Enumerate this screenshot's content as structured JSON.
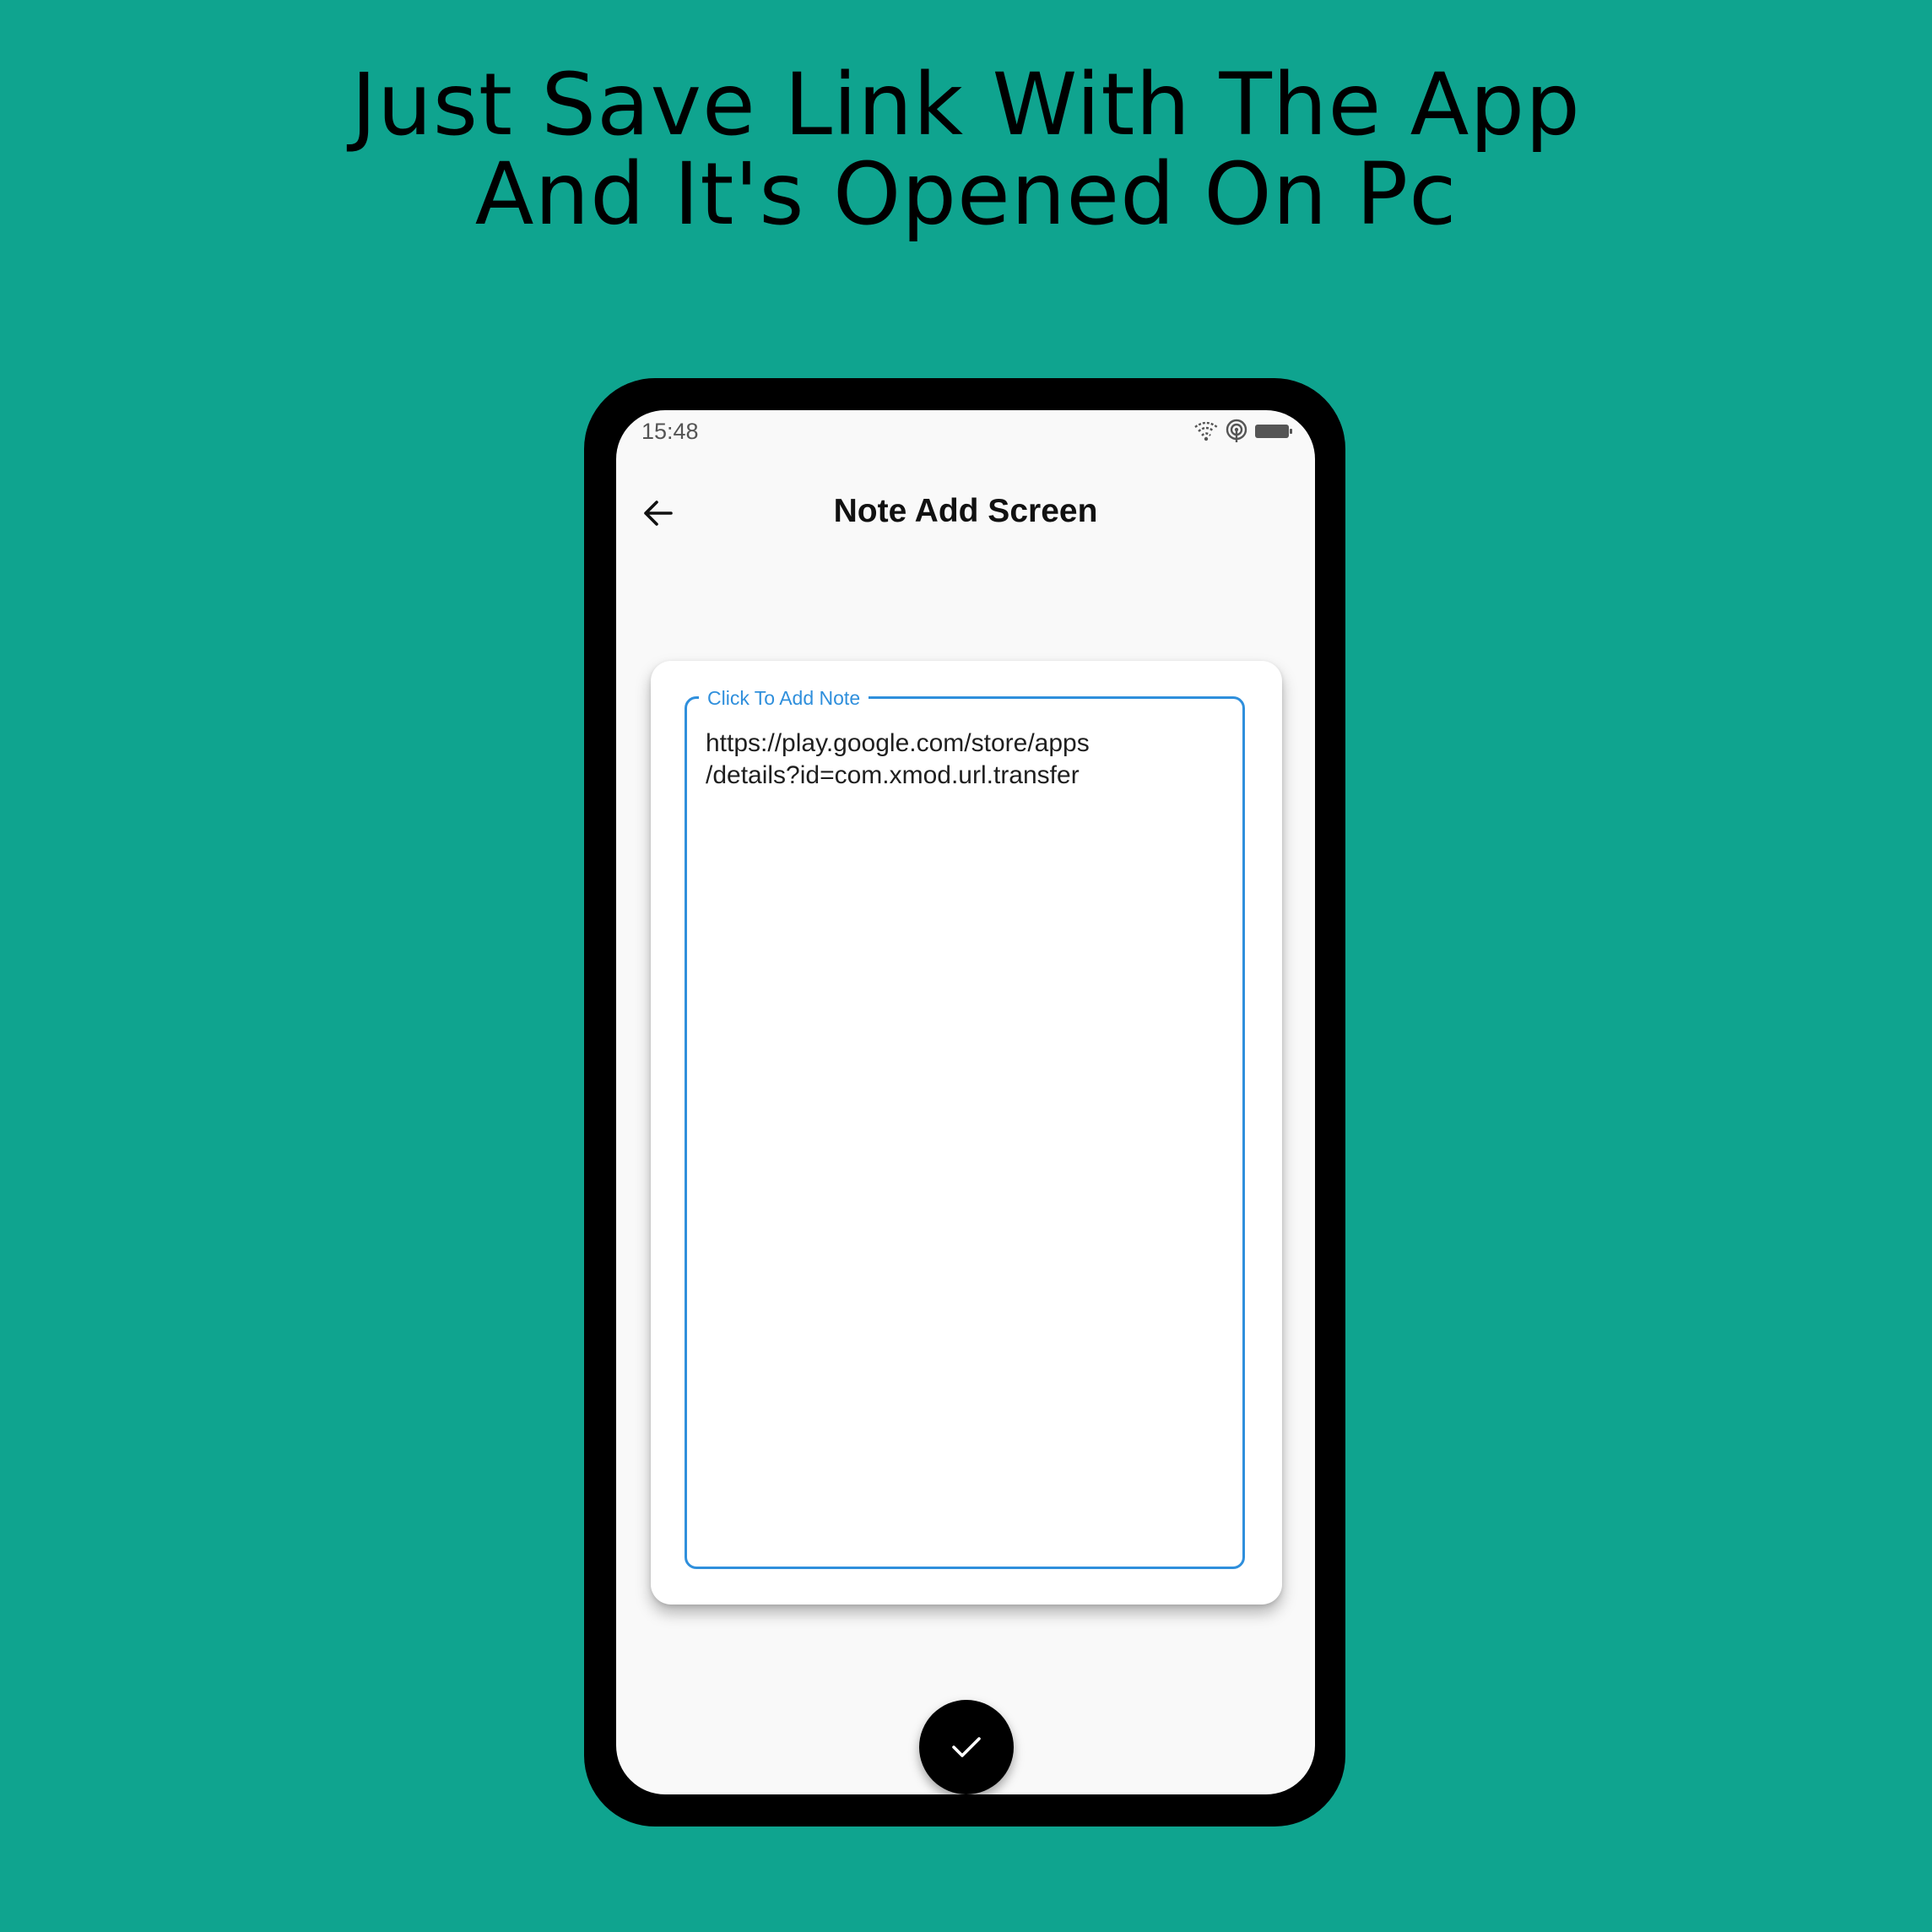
{
  "headline": {
    "line1": "Just Save Link With The App",
    "line2": "And It's Opened On Pc"
  },
  "status_bar": {
    "time": "15:48",
    "icons": [
      "wifi-icon",
      "hotspot-icon",
      "battery-icon"
    ]
  },
  "appbar": {
    "back_icon": "arrow-left-icon",
    "title": "Note Add Screen"
  },
  "note_field": {
    "label": "Click To Add Note",
    "value_line1": "https://play.google.com/store/apps",
    "value_line2": "/details?id=com.xmod.url.transfer"
  },
  "fab": {
    "icon": "check-icon"
  },
  "colors": {
    "background": "#0fa48f",
    "accent": "#2f8fdc",
    "phone_frame": "#000000",
    "screen_bg": "#f9f9f9"
  }
}
